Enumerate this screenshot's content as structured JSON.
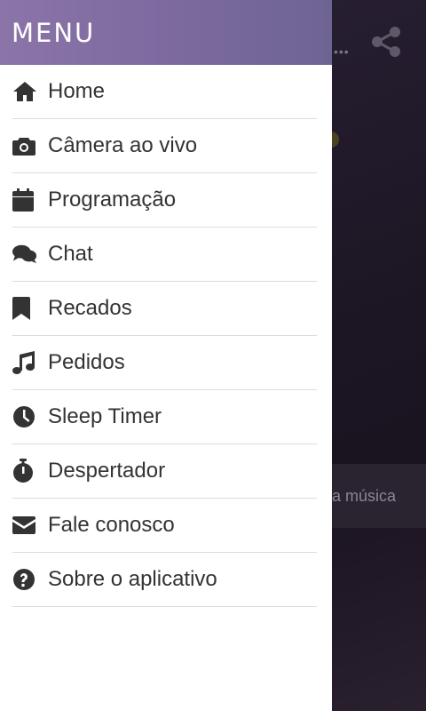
{
  "background": {
    "snippet_text": "a música",
    "dots": "•••"
  },
  "drawer": {
    "title": "MENU",
    "items": [
      {
        "label": "Home",
        "icon": "home-icon"
      },
      {
        "label": "Câmera ao vivo",
        "icon": "camera-icon"
      },
      {
        "label": "Programação",
        "icon": "calendar-icon"
      },
      {
        "label": "Chat",
        "icon": "chat-icon"
      },
      {
        "label": "Recados",
        "icon": "bookmark-icon"
      },
      {
        "label": "Pedidos",
        "icon": "music-icon"
      },
      {
        "label": "Sleep Timer",
        "icon": "clock-icon"
      },
      {
        "label": "Despertador",
        "icon": "stopwatch-icon"
      },
      {
        "label": "Fale conosco",
        "icon": "envelope-icon"
      },
      {
        "label": "Sobre o aplicativo",
        "icon": "question-circle-icon"
      }
    ]
  },
  "colors": {
    "header_gradient_start": "#8b74a8",
    "header_gradient_end": "#6e6493",
    "menu_text": "#333333",
    "divider": "#dcdcdc"
  }
}
